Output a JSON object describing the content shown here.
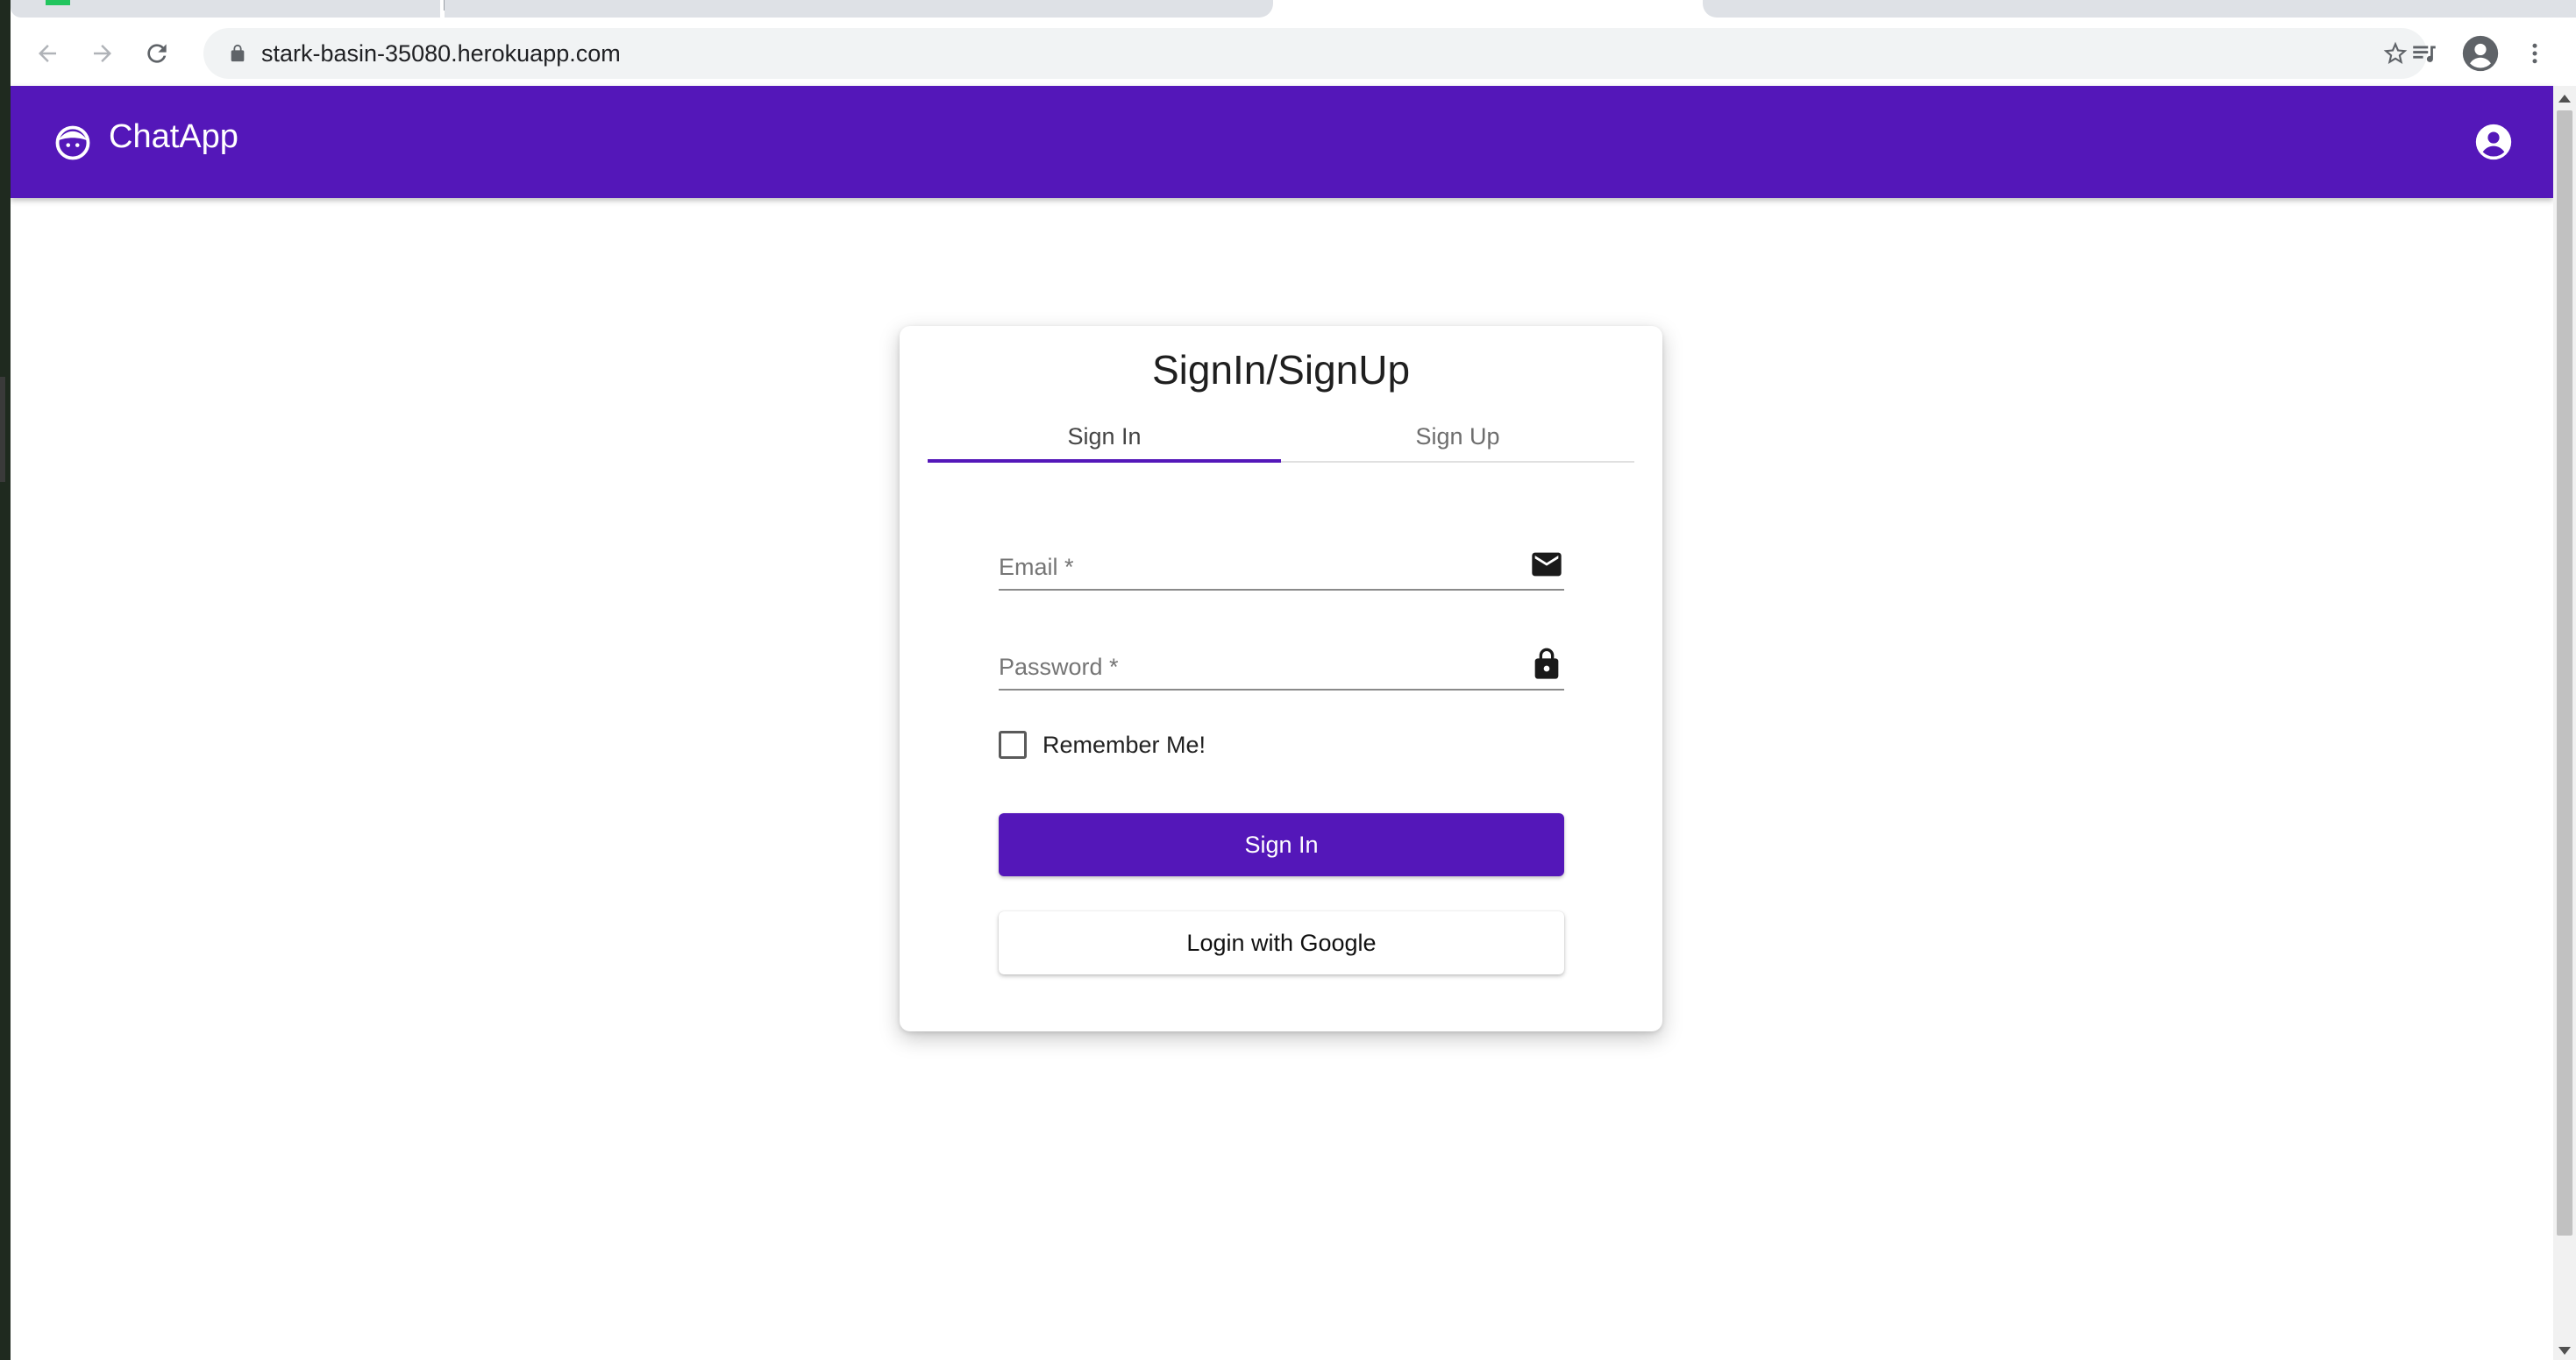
{
  "browser": {
    "url": "stark-basin-35080.herokuapp.com"
  },
  "app": {
    "title": "ChatApp",
    "brand_color": "#5417b9"
  },
  "card": {
    "title": "SignIn/SignUp",
    "tabs": [
      {
        "label": "Sign In",
        "active": true
      },
      {
        "label": "Sign Up",
        "active": false
      }
    ],
    "email_label": "Email *",
    "password_label": "Password *",
    "remember_label": "Remember Me!",
    "remember_checked": false,
    "signin_button": "Sign In",
    "google_button": "Login with Google"
  },
  "icons": {
    "email": "mail-icon",
    "password": "lock-icon",
    "logo": "face-icon",
    "account": "account-circle-icon"
  }
}
